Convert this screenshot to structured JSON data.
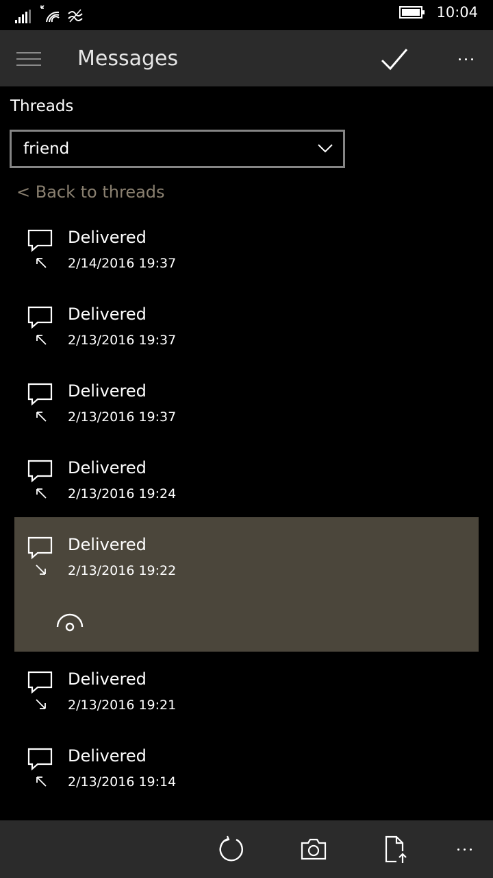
{
  "status_bar": {
    "time": "10:04",
    "icons": [
      "signal-icon",
      "wifi-icon",
      "network-icon",
      "battery-icon"
    ]
  },
  "app_bar": {
    "title": "Messages",
    "icons": [
      "hamburger-menu-icon",
      "checkmark-icon",
      "more-icon"
    ]
  },
  "threads": {
    "label": "Threads",
    "selected_value": "friend"
  },
  "back_link": "< Back to threads",
  "messages": [
    {
      "status": "Delivered",
      "date": "2/14/2016 19:37",
      "direction": "sent"
    },
    {
      "status": "Delivered",
      "date": "2/13/2016 19:37",
      "direction": "sent"
    },
    {
      "status": "Delivered",
      "date": "2/13/2016 19:37",
      "direction": "sent"
    },
    {
      "status": "Delivered",
      "date": "2/13/2016 19:24",
      "direction": "sent"
    },
    {
      "status": "Delivered",
      "date": "2/13/2016 19:22",
      "direction": "received",
      "selected": true
    },
    {
      "status": "Delivered",
      "date": "2/13/2016 19:21",
      "direction": "received"
    },
    {
      "status": "Delivered",
      "date": "2/13/2016 19:14",
      "direction": "sent"
    }
  ],
  "bottom_bar": {
    "icons": [
      "refresh-icon",
      "camera-icon",
      "export-icon",
      "more-icon"
    ]
  },
  "colors": {
    "app_bar": "#2b2b2b",
    "selected_row": "#4b463b",
    "back_link": "#8a8070",
    "combo_border": "#858585"
  }
}
